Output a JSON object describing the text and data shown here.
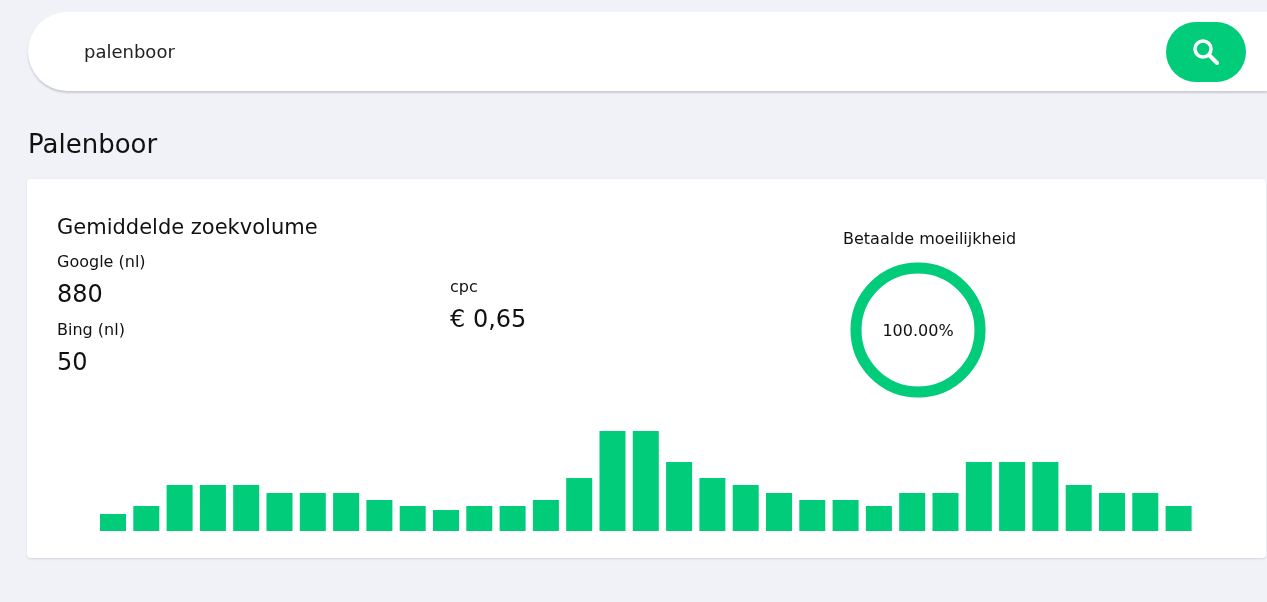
{
  "search": {
    "value": "palenboor"
  },
  "keyword_title": "Palenboor",
  "card": {
    "title": "Gemiddelde zoekvolume",
    "volumes": [
      {
        "label": "Google (nl)",
        "value": "880"
      },
      {
        "label": "Bing (nl)",
        "value": "50"
      }
    ],
    "cpc": {
      "label": "cpc",
      "value": "€ 0,65"
    },
    "difficulty": {
      "label": "Betaalde moeilijkheid",
      "reading": "100.00%",
      "level": 1
    }
  }
}
